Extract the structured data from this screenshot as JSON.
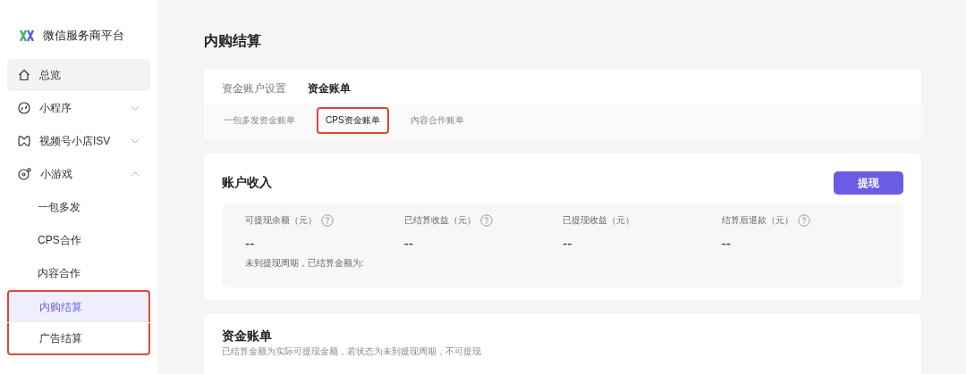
{
  "brand": {
    "name": "微信服务商平台"
  },
  "sidebar": {
    "items": [
      {
        "label": "总览",
        "selected": true
      },
      {
        "label": "小程序",
        "selected": false,
        "expanded": false
      },
      {
        "label": "视频号小店ISV",
        "selected": false,
        "expanded": false
      },
      {
        "label": "小游戏",
        "selected": false,
        "expanded": true,
        "children": [
          {
            "label": "一包多发",
            "selected": false,
            "highlighted": false
          },
          {
            "label": "CPS合作",
            "selected": false,
            "highlighted": false
          },
          {
            "label": "内容合作",
            "selected": false,
            "highlighted": false
          },
          {
            "label": "内购结算",
            "selected": true,
            "highlighted": true
          },
          {
            "label": "广告结算",
            "selected": false,
            "highlighted": true
          }
        ]
      }
    ]
  },
  "page_title": "内购结算",
  "tabs": [
    {
      "label": "资金账户设置",
      "selected": false
    },
    {
      "label": "资金账单",
      "selected": true
    }
  ],
  "subtabs": [
    {
      "label": "一包多发资金账单",
      "selected": false,
      "highlighted": false
    },
    {
      "label": "CPS资金账单",
      "selected": true,
      "highlighted": true
    },
    {
      "label": "内容合作账单",
      "selected": false,
      "highlighted": false
    }
  ],
  "income": {
    "title": "账户收入",
    "button": "提现",
    "stats": [
      {
        "label": "可提现余额（元）",
        "help": true,
        "value": "--"
      },
      {
        "label": "已结算收益（元）",
        "help": true,
        "value": "--"
      },
      {
        "label": "已提现收益（元）",
        "help": false,
        "value": "--"
      },
      {
        "label": "结算后退款（元）",
        "help": true,
        "value": "--"
      }
    ],
    "note": "未到提现周期，已结算金额为:"
  },
  "bill": {
    "title": "资金账单",
    "note": "已结算金额为实际可提现金额，若状态为未到提现周期，不可提现"
  }
}
